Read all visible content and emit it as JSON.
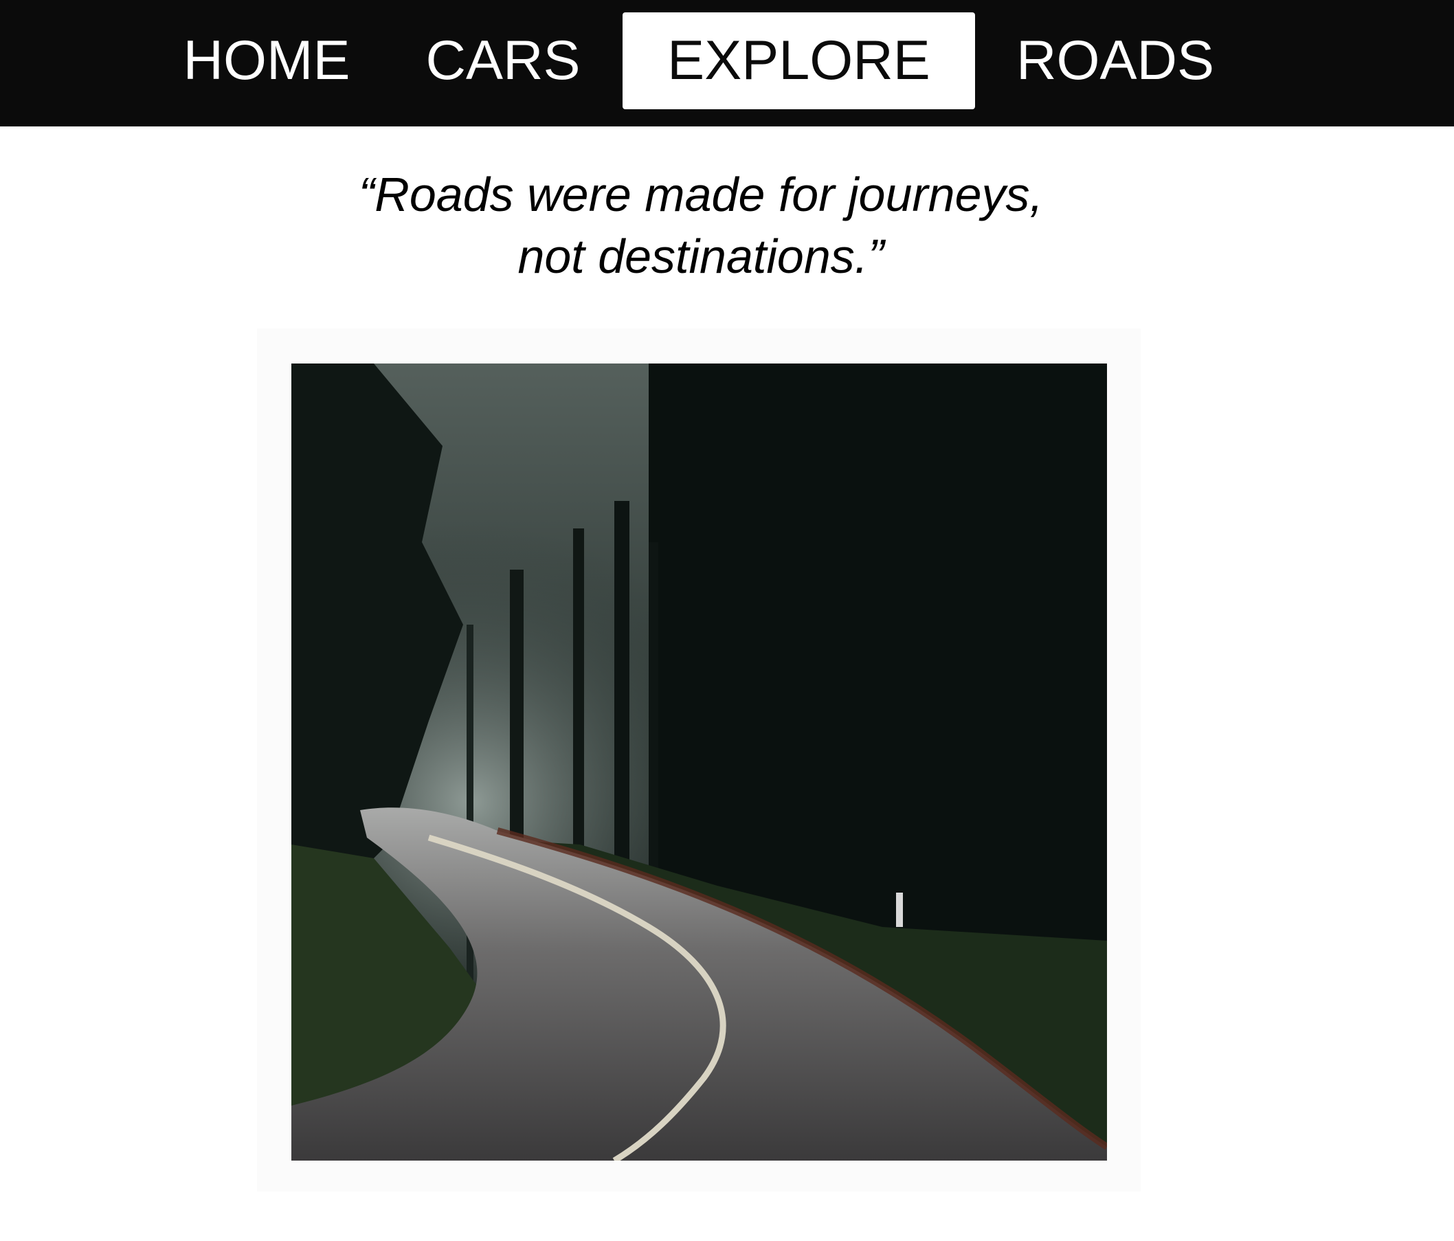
{
  "nav": {
    "items": [
      {
        "label": "HOME",
        "active": false
      },
      {
        "label": "CARS",
        "active": false
      },
      {
        "label": "EXPLORE",
        "active": true
      },
      {
        "label": "ROADS",
        "active": false
      }
    ]
  },
  "quote": {
    "line1": "“Roads were made for journeys,",
    "line2": "not destinations.”"
  },
  "photo": {
    "subject": "winding-forest-road-photo"
  },
  "colors": {
    "navbar_bg": "#0b0b0b",
    "nav_text": "#ffffff",
    "active_bg": "#ffffff",
    "active_text": "#0b0b0b",
    "page_bg": "#ffffff"
  }
}
